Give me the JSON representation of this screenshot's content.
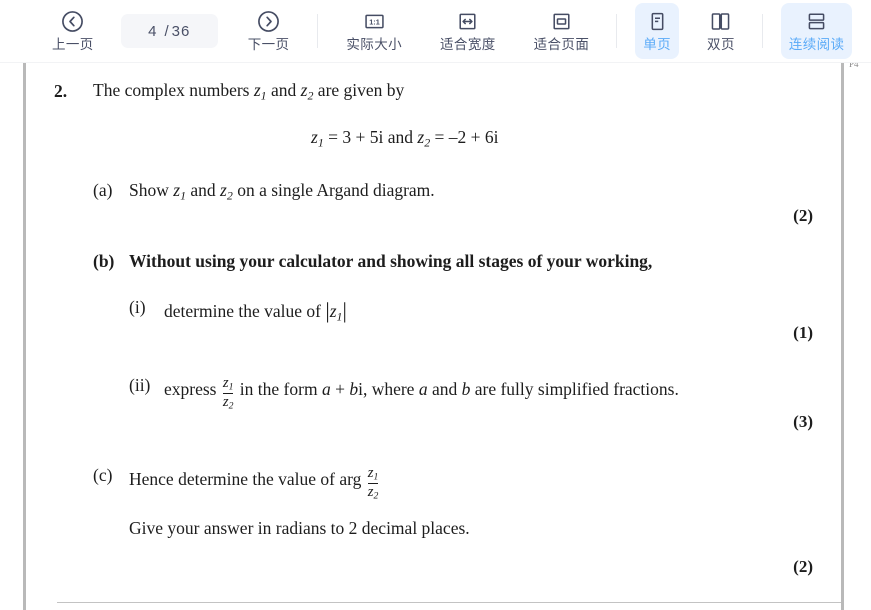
{
  "toolbar": {
    "prev_page": {
      "label": "上一页",
      "icon": "chevron-left-circle-icon"
    },
    "page_indicator": {
      "current": "4",
      "separator": "/",
      "total": "36"
    },
    "next_page": {
      "label": "下一页",
      "icon": "chevron-right-circle-icon"
    },
    "actual_size": {
      "label": "实际大小",
      "icon": "one-to-one-icon"
    },
    "fit_width": {
      "label": "适合宽度",
      "icon": "fit-width-icon"
    },
    "fit_page": {
      "label": "适合页面",
      "icon": "fit-page-icon"
    },
    "single_page": {
      "label": "单页",
      "icon": "single-page-icon",
      "active": true
    },
    "dual_page": {
      "label": "双页",
      "icon": "dual-page-icon",
      "active": false
    },
    "continuous_scroll": {
      "label": "连续阅读",
      "icon": "continuous-scroll-icon",
      "active": true
    },
    "colors": {
      "accent": "#5babf8",
      "accent_bg": "#e9f2fe",
      "text": "#4a5067",
      "pill_bg": "#f5f6f9",
      "separator": "#e8eaee"
    }
  },
  "document": {
    "page_edge_color": "#b9b9b9",
    "corner_ghost_text": "P4",
    "question_number": "2.",
    "stem": {
      "prefix": "The complex numbers ",
      "z1": "z",
      "z1_sub": "1",
      "middle": " and ",
      "z2": "z",
      "z2_sub": "2",
      "suffix": " are given by"
    },
    "equation": {
      "lhs_var": "z",
      "lhs_sub": "1",
      "lhs_value": " = 3 + 5i",
      "conjunction": "  and  ",
      "rhs_var": "z",
      "rhs_sub": "2",
      "rhs_value": " = –2 + 6i"
    },
    "parts": [
      {
        "label": "(a)",
        "text_before": "Show ",
        "var1": "z",
        "var1_sub": "1",
        "text_middle": " and ",
        "var2": "z",
        "var2_sub": "2",
        "text_after": " on a single Argand diagram.",
        "marks": "(2)"
      },
      {
        "label": "(b)",
        "text": "Without using your calculator and showing all stages of your working,",
        "bold": true
      },
      {
        "label": "(i)",
        "text_before": "determine the value of ",
        "modulus_open": "|",
        "var": "z",
        "var_sub": "1",
        "modulus_close": "|",
        "marks": "(1)"
      },
      {
        "label": "(ii)",
        "text_before": "express ",
        "frac_num": "z",
        "frac_num_sub": "1",
        "frac_den": "z",
        "frac_den_sub": "2",
        "text_mid": " in the form ",
        "var_a": "a",
        "plus": " + ",
        "var_b": "b",
        "imag": "i",
        "text_after": ", where ",
        "var_a2": "a",
        "and": " and ",
        "var_b2": "b",
        "text_end": " are fully simplified fractions.",
        "marks": "(3)"
      },
      {
        "label": "(c)",
        "text_before": "Hence determine the value of arg ",
        "frac_num": "z",
        "frac_num_sub": "1",
        "frac_den": "z",
        "frac_den_sub": "2",
        "follow_up": "Give your answer in radians to 2 decimal places.",
        "marks": "(2)"
      }
    ]
  }
}
